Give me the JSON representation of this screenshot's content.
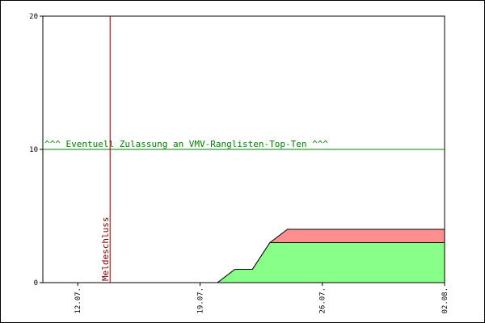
{
  "chart_data": {
    "type": "area",
    "x_start_date": "2023-07-10",
    "ylim": [
      0,
      20
    ],
    "y_ticks": [
      0,
      10,
      20
    ],
    "x_ticks": [
      {
        "label": "12.07.",
        "day": 2
      },
      {
        "label": "19.07.",
        "day": 9
      },
      {
        "label": "26.07.",
        "day": 16
      },
      {
        "label": "02.08.",
        "day": 23
      }
    ],
    "x_range_days": [
      0.75,
      23
    ],
    "grid": false,
    "series": [
      {
        "color": "#88ff88",
        "points": [
          [
            0.75,
            0
          ],
          [
            10,
            0
          ],
          [
            11,
            1
          ],
          [
            12,
            1
          ],
          [
            13,
            3
          ],
          [
            14,
            3
          ],
          [
            23,
            3
          ]
        ]
      },
      {
        "color": "#ff8f8f",
        "points": [
          [
            0.75,
            0
          ],
          [
            10,
            0
          ],
          [
            11,
            1
          ],
          [
            12,
            1
          ],
          [
            13,
            3
          ],
          [
            14,
            4
          ],
          [
            23,
            4
          ]
        ]
      }
    ],
    "annotations": {
      "threshold": {
        "value": 10,
        "label": "^^^ Eventuell Zulassung an VMV-Ranglisten-Top-Ten ^^^",
        "color": "#008000"
      },
      "deadline": {
        "day": 3.85,
        "label": "Meldeschluss",
        "color": "#800000"
      }
    }
  }
}
